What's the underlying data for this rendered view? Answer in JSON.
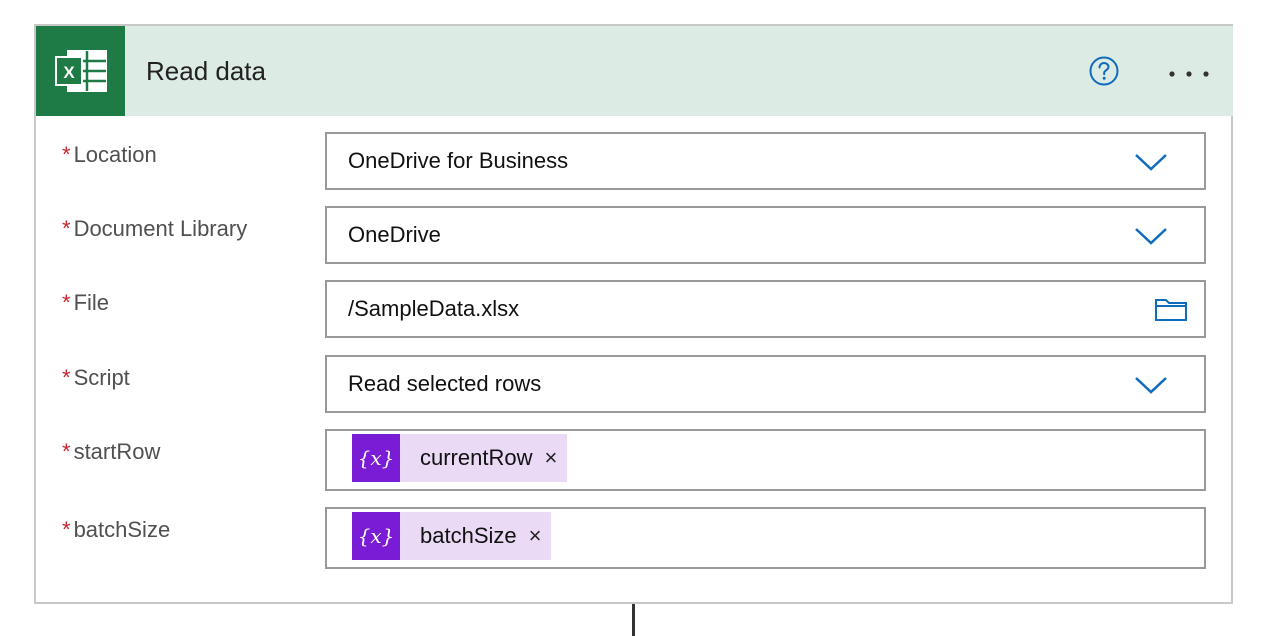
{
  "action": {
    "title": "Read data",
    "app_icon": "excel-icon",
    "help_icon": "help-circle-icon",
    "more_icon": "more-dots-icon"
  },
  "colors": {
    "header_bg": "#dcebe4",
    "app_tile": "#1e7b45",
    "accent": "#0f6cbd",
    "required": "#c4262e",
    "token_icon": "#7a1bd6",
    "token_bg": "#ebdaf5"
  },
  "required_mark": "*",
  "fields": [
    {
      "label": "Location",
      "value": "OneDrive for Business",
      "control": "dropdown"
    },
    {
      "label": "Document Library",
      "value": "OneDrive",
      "control": "dropdown"
    },
    {
      "label": "File",
      "value": "/SampleData.xlsx",
      "control": "file-picker"
    },
    {
      "label": "Script",
      "value": "Read selected rows",
      "control": "dropdown"
    },
    {
      "label": "startRow",
      "token": {
        "icon_text": "{x}",
        "name": "currentRow",
        "close": "×"
      }
    },
    {
      "label": "batchSize",
      "token": {
        "icon_text": "{x}",
        "name": "batchSize",
        "close": "×"
      }
    }
  ]
}
